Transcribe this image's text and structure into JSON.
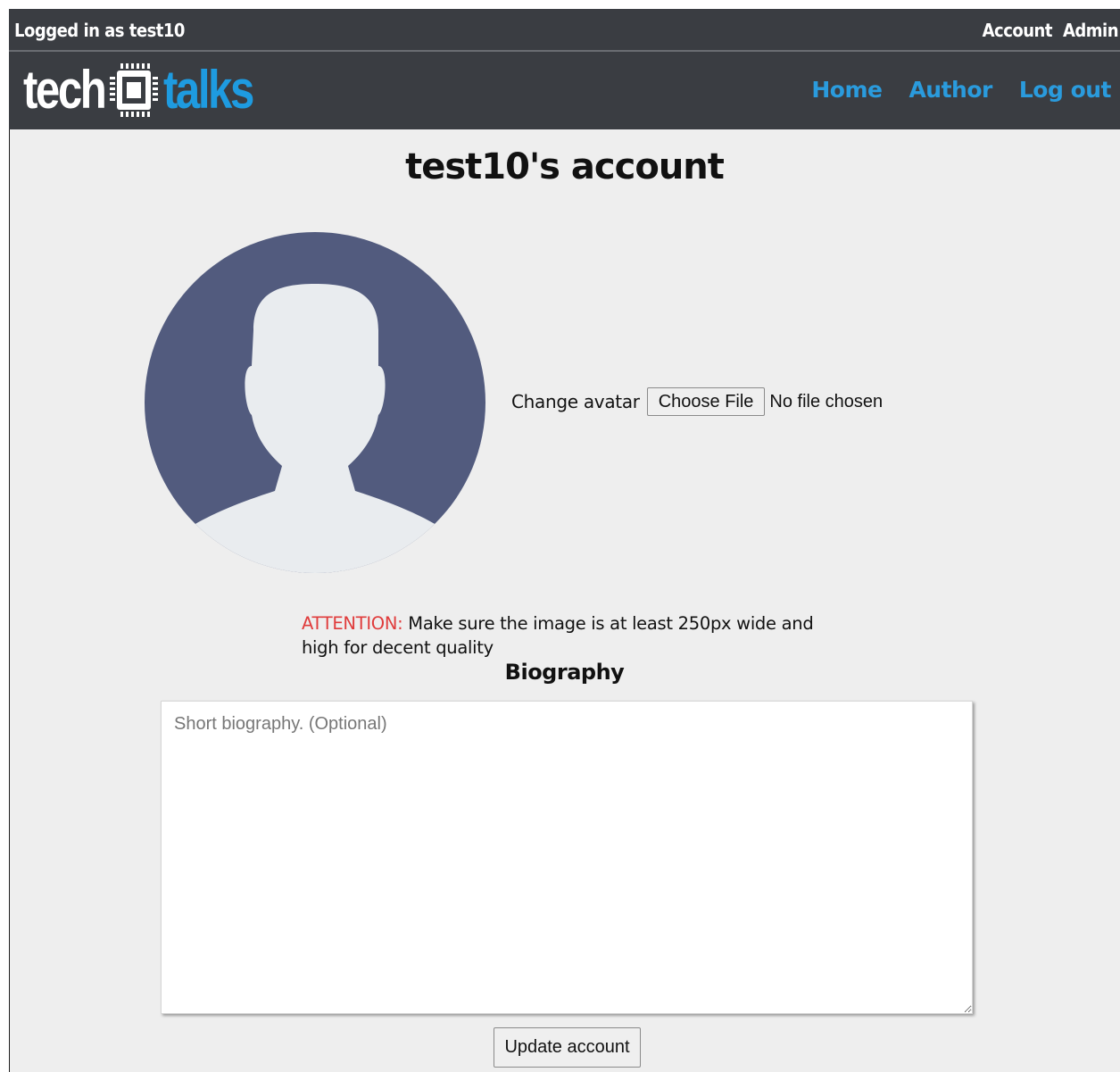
{
  "topbar": {
    "logged_in": "Logged in as test10",
    "links": [
      "Account",
      "Admin"
    ]
  },
  "brand": {
    "part1": "tech",
    "part2": "talks",
    "color_primary": "#ffffff",
    "color_accent": "#1e9be0",
    "icon": "chip-icon"
  },
  "nav": {
    "links": [
      "Home",
      "Author",
      "Log out"
    ],
    "link_color": "#2a9bdd"
  },
  "page": {
    "title": "test10's account"
  },
  "avatar": {
    "icon": "avatar-placeholder-icon",
    "change_label": "Change avatar",
    "choose_file_label": "Choose File",
    "file_status": "No file chosen"
  },
  "attention": {
    "label": "ATTENTION:",
    "text": " Make sure the image is at least 250px wide and high for decent quality",
    "label_color": "#e03c3c"
  },
  "biography": {
    "title": "Biography",
    "placeholder": "Short biography. (Optional)",
    "value": ""
  },
  "actions": {
    "update_label": "Update account"
  }
}
